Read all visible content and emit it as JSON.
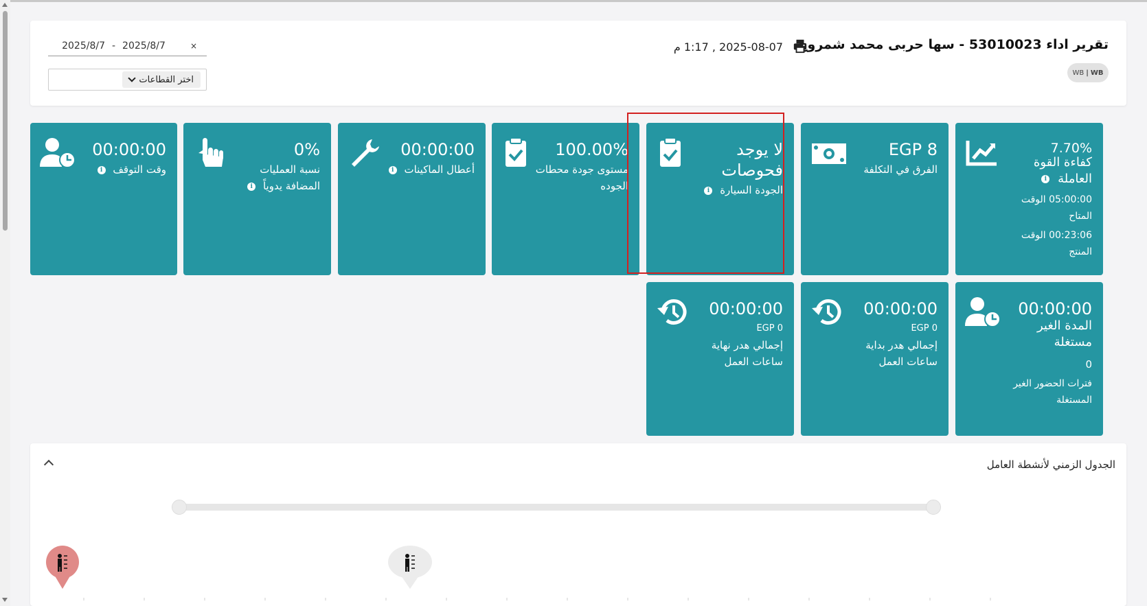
{
  "header": {
    "title": "تقرير اداء 53010023 - سها حربى محمد شمروخ",
    "datetime": "2025-08-07 , 1:17 م",
    "badge_left": "WB",
    "badge_sep": "|",
    "badge_right": "WB",
    "date_from": "2025/8/7",
    "date_sep": "-",
    "date_to": "2025/8/7",
    "date_clear": "×",
    "sector_select_label": "اختر القطاعات"
  },
  "cards": {
    "efficiency": {
      "value": "7.70%",
      "label": "كفاءة القوة العاملة",
      "available_time": "05:00:00",
      "available_label": "الوقت المتاح",
      "productive_time": "00:23:06",
      "productive_label": "الوقت المنتج"
    },
    "cost_diff": {
      "value": "EGP 8",
      "label": "الفرق في التكلفة"
    },
    "car_quality": {
      "value": "لا يوجد فحوصات",
      "label": "الجودة السيارة"
    },
    "quality_stations": {
      "value": "100.00%",
      "label": "مستوى جودة محطات الجوده"
    },
    "machine_faults": {
      "value": "00:00:00",
      "label": "أعطال الماكينات"
    },
    "manual_ops": {
      "value": "0%",
      "label": "نسبة العمليات المضافة يدوياً"
    },
    "downtime": {
      "value": "00:00:00",
      "label": "وقت التوقف"
    },
    "unused_duration": {
      "value": "00:00:00",
      "label": "المدة الغير مستغلة",
      "count": "0",
      "count_label": "فترات الحضور الغير المستغلة"
    },
    "start_waste": {
      "value": "00:00:00",
      "amount": "EGP 0",
      "label": "إجمالي هدر بداية ساعات العمل"
    },
    "end_waste": {
      "value": "00:00:00",
      "amount": "EGP 0",
      "label": "إجمالي هدر نهاية ساعات العمل"
    }
  },
  "timeline": {
    "title": "الجدول الزمني لأنشطة العامل"
  },
  "colors": {
    "card": "#2596a2",
    "highlight": "#d32020",
    "marker_red": "#e08a88",
    "marker_grey": "#ececec"
  }
}
